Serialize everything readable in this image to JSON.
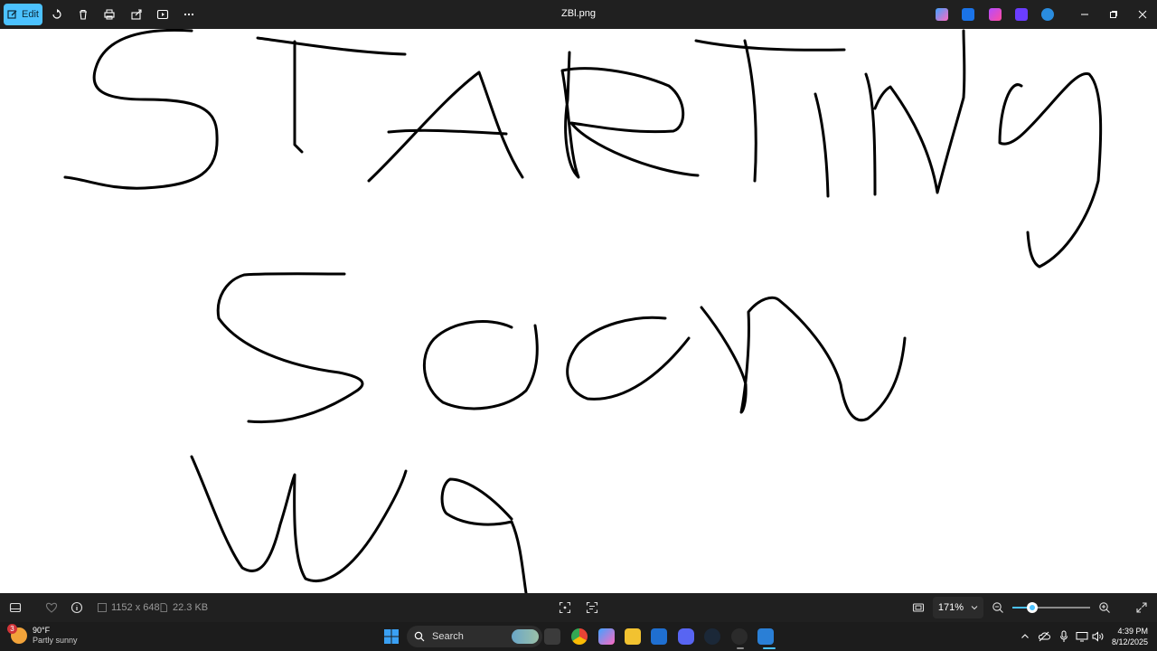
{
  "titlebar": {
    "edit_label": "Edit",
    "file_name": "ZBl.png",
    "icons": [
      "edit-icon",
      "rotate-icon",
      "delete-icon",
      "print-icon",
      "share-icon",
      "slideshow-icon",
      "more-icon"
    ],
    "app_icons": [
      "copilot-icon",
      "paint-icon",
      "clipchamp-icon",
      "designer-icon",
      "onedrive-icon"
    ],
    "window_controls": [
      "minimize-icon",
      "restore-icon",
      "close-icon"
    ]
  },
  "canvas": {
    "drawing_words": [
      "STARTING",
      "Soon",
      "Wg"
    ]
  },
  "statusbar": {
    "dimensions": "1152 x 648",
    "file_size": "22.3 KB",
    "zoom_label": "171%",
    "zoom_fraction": 0.25
  },
  "taskbar": {
    "weather_temp": "90°F",
    "weather_desc": "Partly sunny",
    "weather_badge": "3",
    "search_placeholder": "Search",
    "time": "4:39 PM",
    "date": "8/12/2025",
    "colors": {
      "accent": "#4cc2ff",
      "titlebar": "#202020",
      "taskbar": "#1c1c1c"
    }
  }
}
